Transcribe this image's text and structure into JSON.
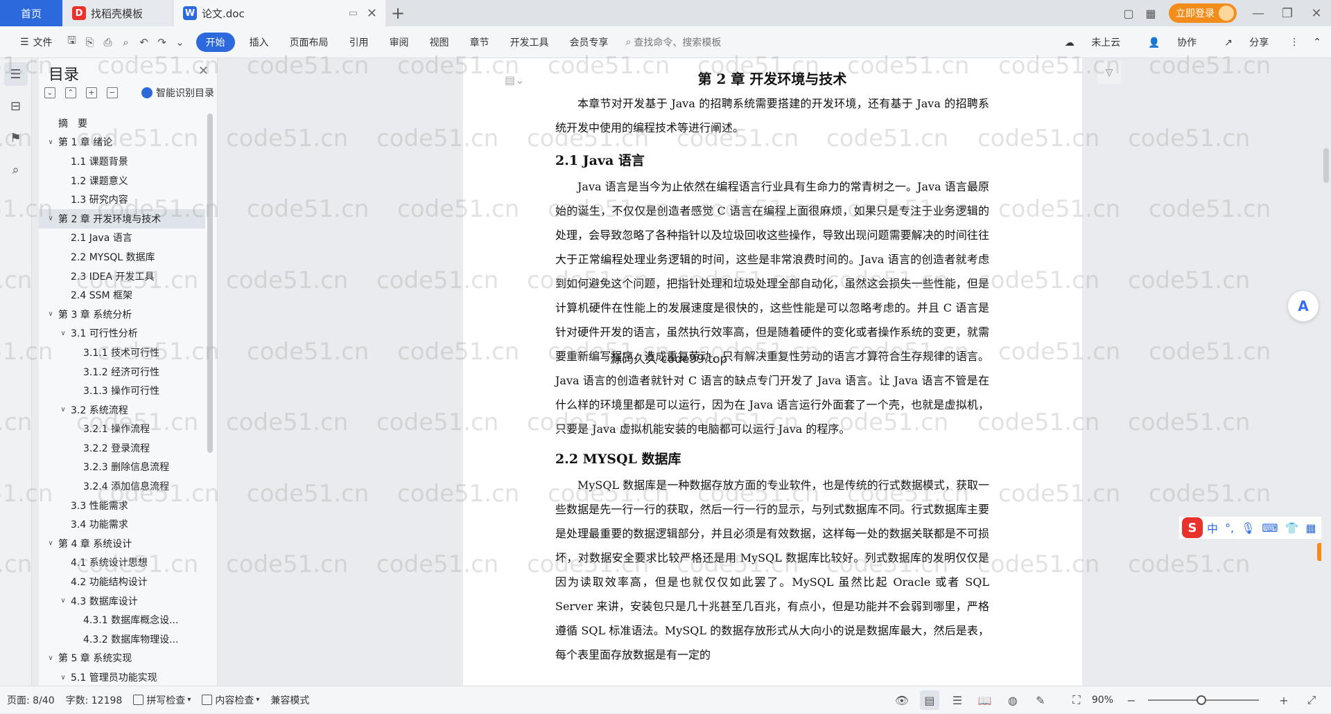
{
  "tabs": {
    "home": "首页",
    "template": "找稻壳模板",
    "doc": "论文.doc",
    "new_tab": "+"
  },
  "titlebar": {
    "login": "立即登录"
  },
  "ribbon": {
    "file": "文件",
    "tabs": [
      "开始",
      "插入",
      "页面布局",
      "引用",
      "审阅",
      "视图",
      "章节",
      "开发工具",
      "会员专享"
    ],
    "search": "查找命令、搜索模板",
    "right": [
      "未上云",
      "协作",
      "分享"
    ]
  },
  "toc": {
    "title": "目录",
    "smart": "智能识别目录",
    "items": [
      {
        "label": "摘　要",
        "level": 0,
        "caret": ""
      },
      {
        "label": "第 1 章  绪论",
        "level": 0,
        "caret": "v"
      },
      {
        "label": "1.1  课题背景",
        "level": 1,
        "caret": ""
      },
      {
        "label": "1.2  课题意义",
        "level": 1,
        "caret": ""
      },
      {
        "label": "1.3  研究内容",
        "level": 1,
        "caret": ""
      },
      {
        "label": "第 2 章  开发环境与技术",
        "level": 0,
        "caret": "v",
        "selected": true
      },
      {
        "label": "2.1  Java 语言",
        "level": 1,
        "caret": ""
      },
      {
        "label": "2.2  MYSQL 数据库",
        "level": 1,
        "caret": ""
      },
      {
        "label": "2.3  IDEA 开发工具",
        "level": 1,
        "caret": ""
      },
      {
        "label": "2.4  SSM 框架",
        "level": 1,
        "caret": ""
      },
      {
        "label": "第 3 章  系统分析",
        "level": 0,
        "caret": "v"
      },
      {
        "label": "3.1  可行性分析",
        "level": 1,
        "caret": "v"
      },
      {
        "label": "3.1.1  技术可行性",
        "level": 2,
        "caret": ""
      },
      {
        "label": "3.1.2  经济可行性",
        "level": 2,
        "caret": ""
      },
      {
        "label": "3.1.3  操作可行性",
        "level": 2,
        "caret": ""
      },
      {
        "label": "3.2  系统流程",
        "level": 1,
        "caret": "v"
      },
      {
        "label": "3.2.1  操作流程",
        "level": 2,
        "caret": ""
      },
      {
        "label": "3.2.2  登录流程",
        "level": 2,
        "caret": ""
      },
      {
        "label": "3.2.3  删除信息流程",
        "level": 2,
        "caret": ""
      },
      {
        "label": "3.2.4  添加信息流程",
        "level": 2,
        "caret": ""
      },
      {
        "label": "3.3  性能需求",
        "level": 1,
        "caret": ""
      },
      {
        "label": "3.4  功能需求",
        "level": 1,
        "caret": ""
      },
      {
        "label": "第 4 章  系统设计",
        "level": 0,
        "caret": "v"
      },
      {
        "label": "4.1  系统设计思想",
        "level": 1,
        "caret": ""
      },
      {
        "label": "4.2  功能结构设计",
        "level": 1,
        "caret": ""
      },
      {
        "label": "4.3  数据库设计",
        "level": 1,
        "caret": "v"
      },
      {
        "label": "4.3.1  数据库概念设...",
        "level": 2,
        "caret": ""
      },
      {
        "label": "4.3.2  数据库物理设...",
        "level": 2,
        "caret": ""
      },
      {
        "label": "第 5 章  系统实现",
        "level": 0,
        "caret": "v"
      },
      {
        "label": "5.1  管理员功能实现",
        "level": 1,
        "caret": "v"
      }
    ]
  },
  "document": {
    "chapter_title": "第 2 章  开发环境与技术",
    "intro": "本章节对开发基于 Java 的招聘系统需要搭建的开发环境，还有基于 Java 的招聘系统开发中使用的编程技术等进行阐述。",
    "sec1_title": "2.1 Java 语言",
    "sec1_para": "Java 语言是当今为止依然在编程语言行业具有生命力的常青树之一。Java 语言最原始的诞生，不仅仅是创造者感觉 C 语言在编程上面很麻烦，如果只是专注于业务逻辑的处理，会导致忽略了各种指针以及垃圾回收这些操作，导致出现问题需要解决的时间往往大于正常编程处理业务逻辑的时间，这些是非常浪费时间的。Java 语言的创造者就考虑到如何避免这个问题，把指针处理和垃圾处理全部自动化，虽然这会损失一些性能，但是计算机硬件在性能上的发展速度是很快的，这些性能是可以忽略考虑的。并且 C 语言是针对硬件开发的语言，虽然执行效率高，但是随着硬件的变化或者操作系统的变更，就需要重新编写程序，造成重复劳动，只有解决重复性劳动的语言才算符合生存规律的语言。Java 语言的创造者就针对 C 语言的缺点专门开发了 Java 语言。让 Java 语言不管是在什么样的环境里都是可以运行，因为在 Java 语言运行外面套了一个壳，也就是虚拟机，只要是 Java 虚拟机能安装的电脑都可以运行 Java 的程序。",
    "sec2_title": "2.2 MYSQL 数据库",
    "sec2_para": "MySQL 数据库是一种数据存放方面的专业软件，也是传统的行式数据模式，获取一些数据是先一行一行的获取，然后一行一行的显示，与列式数据库不同。行式数据库主要是处理最重要的数据逻辑部分，并且必须是有效数据，这样每一处的数据关联都是不可损坏，对数据安全要求比较严格还是用 MySQL 数据库比较好。列式数据库的发明仅仅是因为读取效率高，但是也就仅仅如此罢了。MySQL 虽然比起 Oracle 或者 SQL Server 来讲，安装包只是几十兆甚至几百兆，有点小，但是功能并不会弱到哪里，严格遵循 SQL 标准语法。MySQL 的数据存放形式从大向小的说是数据库最大，然后是表，每个表里面存放数据是有一定的",
    "overlay": "源码久久 code99.top"
  },
  "watermark": "code51.cn",
  "ime": {
    "lang": "中",
    "punct": "°,"
  },
  "status": {
    "page": "页面: 8/40",
    "words": "字数: 12198",
    "spell": "拼写检查",
    "content_check": "内容检查",
    "compat": "兼容模式",
    "zoom": "90%"
  }
}
